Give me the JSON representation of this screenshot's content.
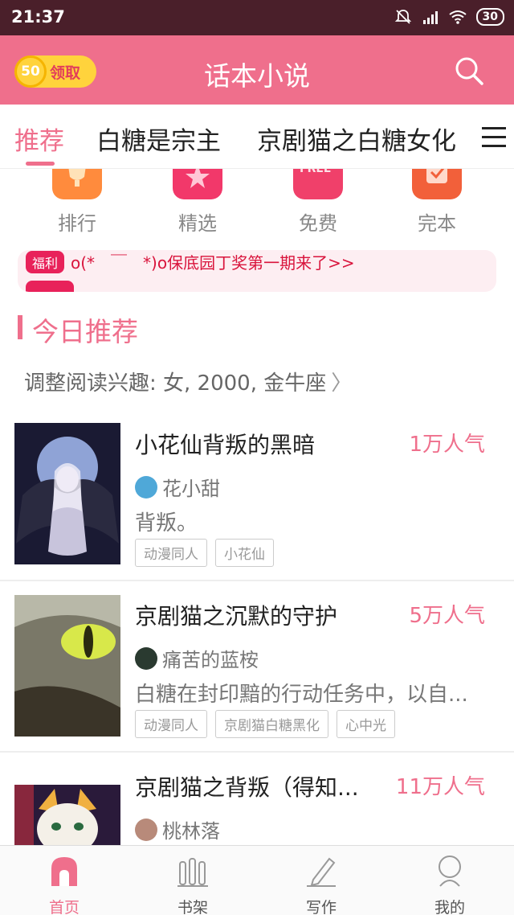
{
  "status_bar": {
    "time": "21:37",
    "battery": "30"
  },
  "header": {
    "coin_value": "50",
    "coin_label": "领取",
    "title": "话本小说"
  },
  "tabs": [
    {
      "label": "推荐",
      "active": true
    },
    {
      "label": "白糖是宗主",
      "active": false
    },
    {
      "label": "京剧猫之白糖女化",
      "active": false
    }
  ],
  "quick_links": [
    {
      "label": "排行",
      "icon": "trophy-icon"
    },
    {
      "label": "精选",
      "icon": "star-icon"
    },
    {
      "label": "免费",
      "icon": "free-icon",
      "badge": "FREE"
    },
    {
      "label": "完本",
      "icon": "check-icon"
    }
  ],
  "notice": {
    "tag": "福利",
    "text": "o(*　￣　*)o保底园丁奖第一期来了>>"
  },
  "section": {
    "title": "今日推荐",
    "interest": "调整阅读兴趣: 女, 2000, 金牛座",
    "interest_chevron": "〉"
  },
  "books": [
    {
      "title": "小花仙背叛的黑暗",
      "popularity": "1万人气",
      "author": "花小甜",
      "description": "背叛。",
      "tags": [
        "动漫同人",
        "小花仙"
      ]
    },
    {
      "title": "京剧猫之沉默的守护",
      "popularity": "5万人气",
      "author": "痛苦的蓝桉",
      "description": "白糖在封印黯的行动任务中，以自...",
      "tags": [
        "动漫同人",
        "京剧猫白糖黑化",
        "心中光"
      ]
    },
    {
      "title": "京剧猫之背叛（得知...",
      "popularity": "11万人气",
      "author": "桃林落",
      "description": "",
      "tags": []
    }
  ],
  "bottom_nav": [
    {
      "label": "首页",
      "active": true
    },
    {
      "label": "书架",
      "active": false
    },
    {
      "label": "写作",
      "active": false
    },
    {
      "label": "我的",
      "active": false
    }
  ],
  "colors": {
    "accent": "#ef6f8c",
    "status_bar": "#4a1f2a",
    "notice_red": "#d9143c"
  }
}
